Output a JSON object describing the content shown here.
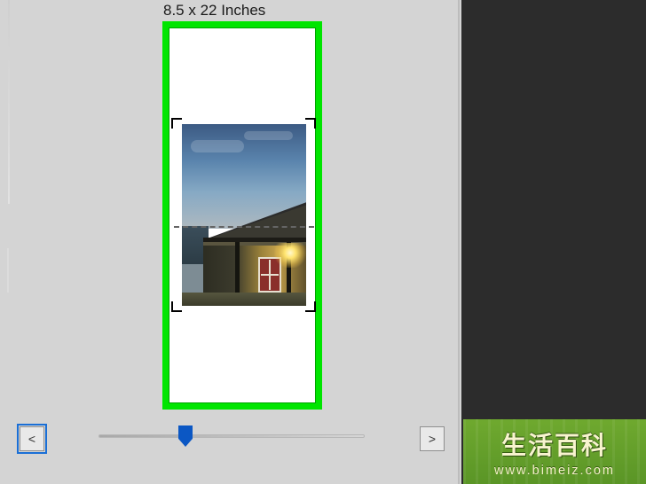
{
  "page_size_label": "8.5 x 22 Inches",
  "nav": {
    "prev": "<",
    "next": ">"
  },
  "watermark": {
    "title_cn": "生活百科",
    "url": "www.bimeiz.com"
  },
  "colors": {
    "highlight_frame": "#00e500",
    "focus_ring": "#1a6fd6",
    "slider_thumb": "#0b57c4"
  }
}
